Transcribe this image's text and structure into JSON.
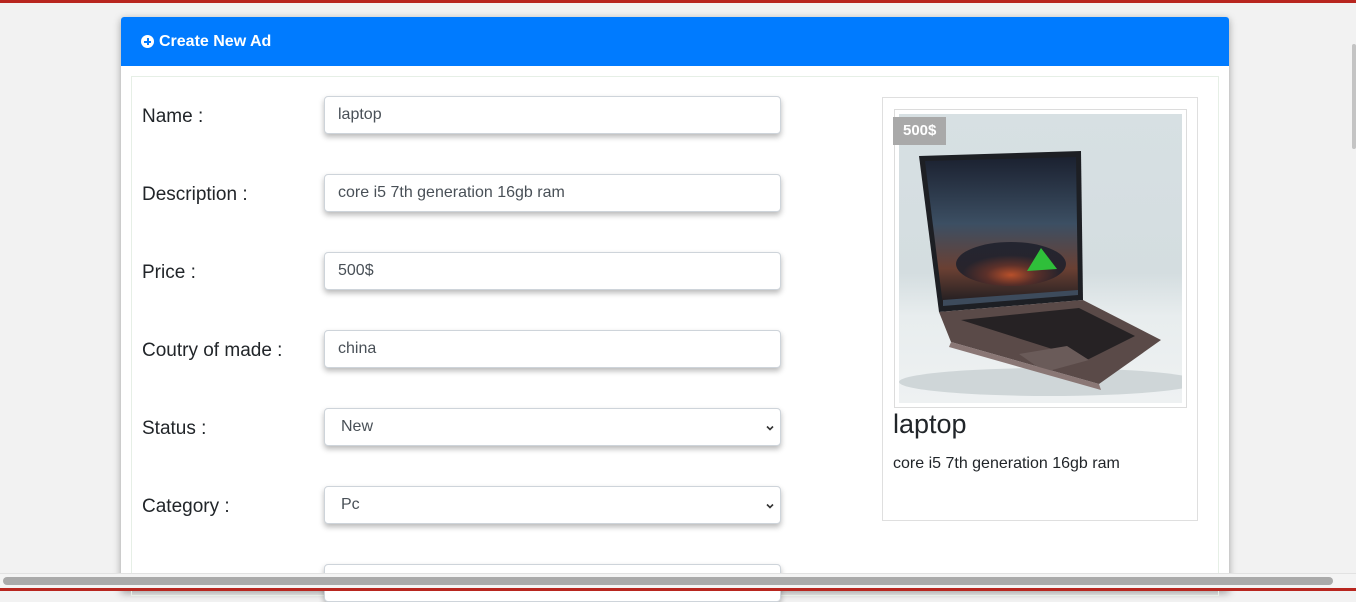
{
  "header": {
    "icon": "plus-circle-icon",
    "title": "Create New Ad"
  },
  "form": {
    "name": {
      "label": "Name :",
      "value": "laptop"
    },
    "description": {
      "label": "Description :",
      "value": "core i5 7th generation 16gb ram"
    },
    "price": {
      "label": "Price :",
      "value": "500$"
    },
    "country": {
      "label": "Coutry of made :",
      "value": "china"
    },
    "status": {
      "label": "Status :",
      "selected": "New"
    },
    "category": {
      "label": "Category :",
      "selected": "Pc"
    }
  },
  "preview": {
    "price_badge": "500$",
    "title": "laptop",
    "description": "core i5 7th generation 16gb ram"
  },
  "colors": {
    "header_bg": "#007bff",
    "accent_strip": "#b8261f",
    "badge_bg": "#a9a9a9"
  }
}
